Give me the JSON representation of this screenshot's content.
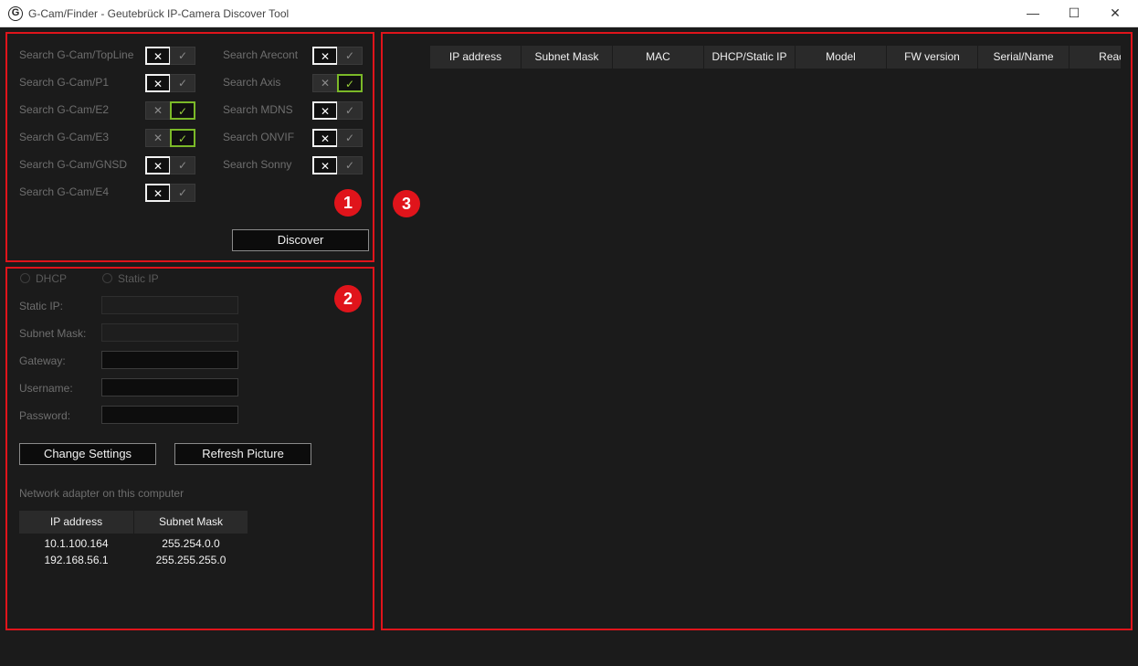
{
  "window": {
    "icon_glyph": "G",
    "title": "G-Cam/Finder - Geutebrück IP-Camera Discover Tool",
    "minimize_glyph": "—",
    "maximize_glyph": "☐",
    "close_glyph": "✕"
  },
  "badges": [
    "1",
    "2",
    "3"
  ],
  "search": {
    "left": [
      {
        "label": "Search G-Cam/TopLine",
        "state": "off"
      },
      {
        "label": "Search G-Cam/P1",
        "state": "off"
      },
      {
        "label": "Search G-Cam/E2",
        "state": "on"
      },
      {
        "label": "Search G-Cam/E3",
        "state": "on"
      },
      {
        "label": "Search G-Cam/GNSD",
        "state": "off"
      },
      {
        "label": "Search G-Cam/E4",
        "state": "off"
      }
    ],
    "right": [
      {
        "label": "Search Arecont",
        "state": "off"
      },
      {
        "label": "Search Axis",
        "state": "on"
      },
      {
        "label": "Search MDNS",
        "state": "off"
      },
      {
        "label": "Search ONVIF",
        "state": "off"
      },
      {
        "label": "Search Sonny",
        "state": "off"
      }
    ],
    "x_glyph": "✕",
    "check_glyph": "✓",
    "discover_label": "Discover"
  },
  "settings": {
    "radio_dhcp": "DHCP",
    "radio_static": "Static IP",
    "static_ip_label": "Static IP:",
    "subnet_label": "Subnet Mask:",
    "gateway_label": "Gateway:",
    "username_label": "Username:",
    "password_label": "Password:",
    "change_label": "Change Settings",
    "refresh_label": "Refresh Picture",
    "adapter_title": "Network adapter on this computer",
    "adapter_headers": [
      "IP address",
      "Subnet Mask"
    ],
    "adapter_rows": [
      [
        "10.1.100.164",
        "255.254.0.0"
      ],
      [
        "192.168.56.1",
        "255.255.255.0"
      ]
    ]
  },
  "results": {
    "columns": [
      "IP address",
      "Subnet Mask",
      "MAC",
      "DHCP/Static IP",
      "Model",
      "FW version",
      "Serial/Name",
      "Reach"
    ]
  },
  "colors": {
    "accent_red": "#e0141b",
    "toggle_green": "#7bb928",
    "background": "#1b1b1b"
  }
}
